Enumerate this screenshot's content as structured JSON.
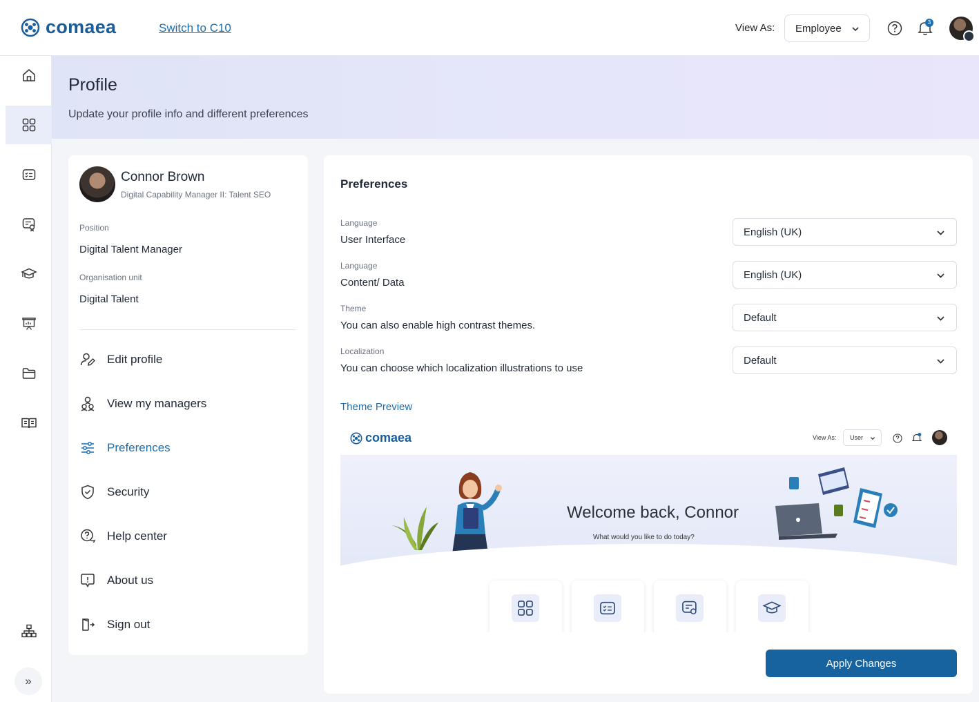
{
  "header": {
    "brand": "comaea",
    "switch_link": "Switch to C10",
    "view_as_label": "View As:",
    "view_as_value": "Employee",
    "notification_count": "3"
  },
  "sidebar": {
    "items": [
      {
        "icon": "home-icon"
      },
      {
        "icon": "dashboard-icon",
        "active": true
      },
      {
        "icon": "list-card-icon"
      },
      {
        "icon": "certificate-icon"
      },
      {
        "icon": "graduation-cap-icon"
      },
      {
        "icon": "presentation-icon"
      },
      {
        "icon": "folder-icon"
      },
      {
        "icon": "book-icon"
      },
      {
        "icon": "org-chart-icon"
      }
    ]
  },
  "banner": {
    "title": "Profile",
    "subtitle": "Update your profile info and different preferences"
  },
  "profile": {
    "name": "Connor Brown",
    "role": "Digital Capability Manager II: Talent SEO",
    "position_label": "Position",
    "position_value": "Digital Talent Manager",
    "org_label": "Organisation unit",
    "org_value": "Digital Talent",
    "menu": [
      {
        "label": "Edit profile",
        "icon": "edit-user-icon"
      },
      {
        "label": "View my managers",
        "icon": "managers-icon"
      },
      {
        "label": "Preferences",
        "icon": "sliders-icon",
        "active": true
      },
      {
        "label": "Security",
        "icon": "shield-icon"
      },
      {
        "label": "Help center",
        "icon": "help-chat-icon"
      },
      {
        "label": "About us",
        "icon": "info-icon"
      },
      {
        "label": "Sign out",
        "icon": "sign-out-icon"
      }
    ]
  },
  "preferences": {
    "title": "Preferences",
    "rows": [
      {
        "label": "Language",
        "desc": "User Interface",
        "value": "English (UK)"
      },
      {
        "label": "Language",
        "desc": "Content/ Data",
        "value": "English (UK)"
      },
      {
        "label": "Theme",
        "desc": "You can also enable high contrast themes.",
        "value": "Default"
      },
      {
        "label": "Localization",
        "desc": "You can choose which localization illustrations to use",
        "value": "Default"
      }
    ],
    "theme_preview_label": "Theme Preview",
    "apply_button": "Apply Changes"
  },
  "preview": {
    "brand": "comaea",
    "view_as_label": "View As:",
    "view_as_value": "User",
    "welcome": "Welcome back, Connor",
    "welcome_sub": "What would you like to do today?"
  },
  "colors": {
    "brand": "#1a5d99",
    "accent": "#1a6fb0",
    "button": "#16639f",
    "banner_start": "#dfe4f6",
    "banner_end": "#e9e5fb"
  }
}
